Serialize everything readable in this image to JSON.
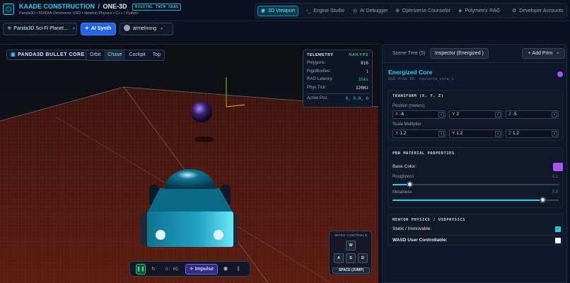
{
  "header": {
    "brand": "KAADE CONSTRUCTION",
    "product": "ONE-3D",
    "badge": "DIGITAL TWIN SAAS",
    "subtitle": "Panda3D • NVIDIA Omniverse USD • Newton Physics • C++ / Python",
    "logo_icon": "cube-icon"
  },
  "nav": {
    "items": [
      {
        "label": "3D Viewport",
        "icon": "viewport-icon",
        "active": true
      },
      {
        "label": "Engine Studio",
        "icon": "terminal-icon"
      },
      {
        "label": "AI Debugger",
        "icon": "debug-icon"
      },
      {
        "label": "Openverse Counselor",
        "icon": "compass-icon"
      },
      {
        "label": "Polymetric RAG",
        "icon": "rag-icon"
      },
      {
        "label": "Developer Accounts",
        "icon": "gear-icon"
      }
    ]
  },
  "toolbar": {
    "scene_select": "Panda3D Sci-Fi Planet…",
    "ai_synth": "AI Synth",
    "user": "armelnong"
  },
  "viewport": {
    "core_label": "PANDA3D BULLET CORE",
    "camera_modes": [
      "Orbit",
      "Chase",
      "Cockpit",
      "Top"
    ],
    "camera_active": "Chase",
    "telemetry": {
      "title": "TELEMETRY",
      "fps": "NAN FPS",
      "rows": [
        {
          "label": "Polygons:",
          "value": "816",
          "color": "white"
        },
        {
          "label": "RigidBodies:",
          "value": "1",
          "color": "yellow"
        },
        {
          "label": "RAG Latency:",
          "value": "16ms",
          "color": "green"
        },
        {
          "label": "Phys Tick:",
          "value": "120Hz",
          "color": "white"
        }
      ],
      "active_pos_label": "Active Pos:",
      "active_pos_value": "0, 0.0, 0"
    },
    "wasd": {
      "title": "WASD CONTROLS",
      "keys": [
        "W",
        "A",
        "S",
        "D"
      ],
      "space": "SPACE (JUMP)"
    },
    "bottom": {
      "gravity": "G: 0G",
      "impulse": "Impulse",
      "icons": [
        "pause-icon",
        "reset-icon",
        "shape-icon",
        "sliders-icon"
      ]
    }
  },
  "panel": {
    "tabs": [
      "Scene Tree (5)",
      "Inspector (Energized )"
    ],
    "active_tab": "Inspector (Energized )",
    "add_prim": "+ Add Prim",
    "prim_title": "Energized Core",
    "prim_id": "USD Prim ID: resource_core_1",
    "prim_color": "#a855f7",
    "transform": {
      "title": "TRANSFORM (X, Y, Z)",
      "position_label": "Position (meters)",
      "position": [
        "-6",
        "2",
        "-5"
      ],
      "scale_label": "Scale Multiplier",
      "scale": [
        "1.2",
        "1.2",
        "1.2"
      ]
    },
    "material": {
      "title": "PBR MATERIAL PROPERTIES",
      "base_color_label": "Base Color:",
      "base_color": "#a855f7",
      "roughness_label": "Roughness",
      "roughness": 0.1,
      "roughness_text": "0.1",
      "metalness_label": "Metalness",
      "metalness": 0.9,
      "metalness_text": "0.9"
    },
    "physics": {
      "title": "NEWTON PHYSICS / USDPHYSICS",
      "static_label": "Static / Immovable:",
      "static": true,
      "wasd_label": "WASD User Controllable:",
      "wasd": false
    }
  }
}
